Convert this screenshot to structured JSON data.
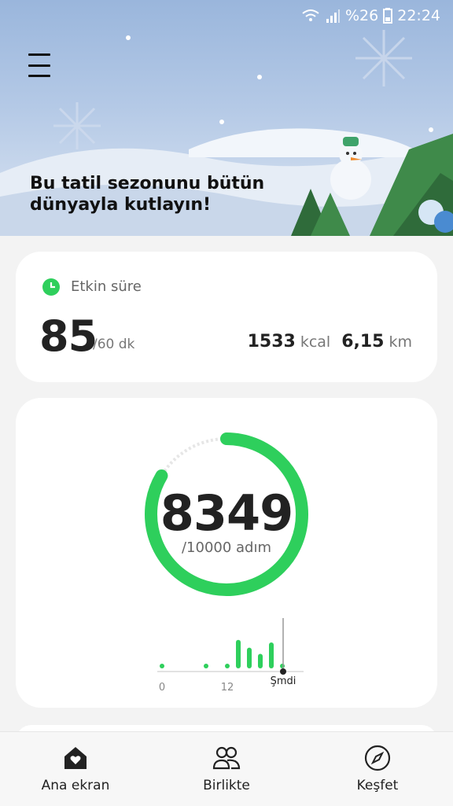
{
  "status_bar": {
    "battery": "%26",
    "time": "22:24"
  },
  "banner": {
    "title": "Bu tatil sezonunu bütün dünyayla kutlayın!"
  },
  "active_time": {
    "label": "Etkin süre",
    "value": "85",
    "goal": "/60 dk",
    "calories_value": "1533",
    "calories_unit": "kcal",
    "distance_value": "6,15",
    "distance_unit": "km"
  },
  "steps": {
    "value": "8349",
    "goal_text": "/10000 adım",
    "progress": 0.8349
  },
  "activity_chart": {
    "x_tick_labels": [
      "0",
      "12",
      "Şmdi"
    ],
    "bars": [
      0.05,
      0.06,
      0.05,
      0.55,
      0.4,
      0.28,
      0.5,
      0.05
    ]
  },
  "colors": {
    "accent": "#2ecf5c",
    "ring_track": "#e6e6e6"
  },
  "bottom_nav": {
    "items": [
      {
        "label": "Ana ekran",
        "icon": "home-heart-icon"
      },
      {
        "label": "Birlikte",
        "icon": "people-icon"
      },
      {
        "label": "Keşfet",
        "icon": "compass-icon"
      }
    ]
  }
}
